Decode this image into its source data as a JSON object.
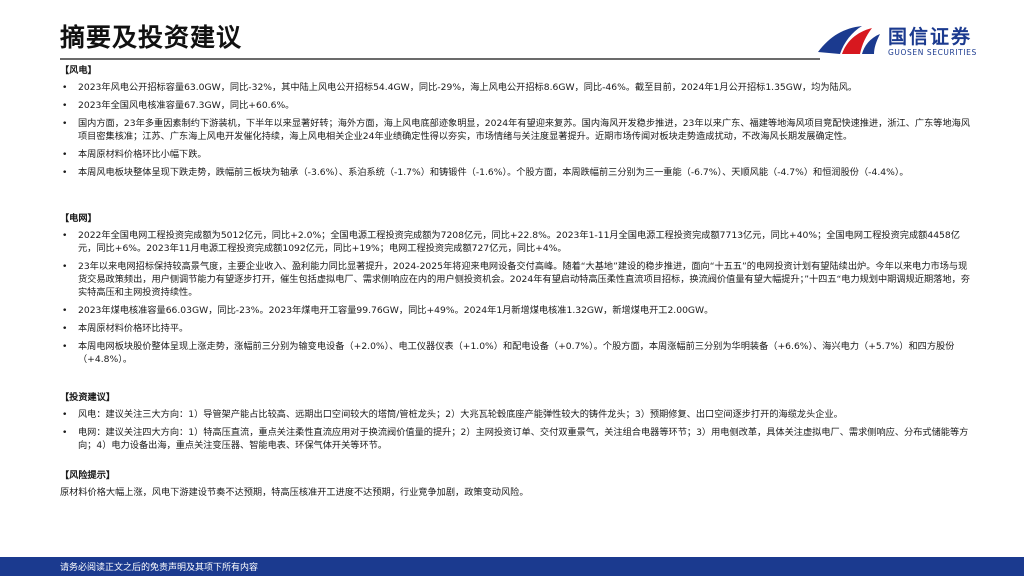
{
  "page": {
    "title": "摘要及投资建议"
  },
  "brand": {
    "name_cn": "国信证券",
    "name_en": "GUOSEN SECURITIES",
    "primary_color": "#1b3a8f",
    "accent_color": "#d7181f"
  },
  "sections": {
    "wind": {
      "heading": "【风电】",
      "items": [
        "2023年风电公开招标容量63.0GW，同比-32%，其中陆上风电公开招标54.4GW，同比-29%，海上风电公开招标8.6GW，同比-46%。截至目前，2024年1月公开招标1.35GW，均为陆风。",
        "2023年全国风电核准容量67.3GW，同比+60.6%。",
        "国内方面，23年多重因素制约下游装机，下半年以来显著好转；海外方面，海上风电底部迹象明显，2024年有望迎来复苏。国内海风开发稳步推进，23年以来广东、福建等地海风项目竞配快速推进，浙江、广东等地海风项目密集核准；江苏、广东海上风电开发催化持续，海上风电相关企业24年业绩确定性得以夯实，市场情绪与关注度显著提升。近期市场传闻对板块走势造成扰动，不改海风长期发展确定性。",
        "本周原材料价格环比小幅下跌。",
        "本周风电板块整体呈现下跌走势，跌幅前三板块为轴承（-3.6%）、系泊系统（-1.7%）和铸锻件（-1.6%）。个股方面，本周跌幅前三分别为三一重能（-6.7%）、天顺风能（-4.7%）和恒润股份（-4.4%）。"
      ]
    },
    "grid": {
      "heading": "【电网】",
      "items": [
        "2022年全国电网工程投资完成额为5012亿元，同比+2.0%；全国电源工程投资完成额为7208亿元，同比+22.8%。2023年1-11月全国电源工程投资完成额7713亿元，同比+40%；全国电网工程投资完成额4458亿元，同比+6%。2023年11月电源工程投资完成额1092亿元，同比+19%；电网工程投资完成额727亿元，同比+4%。",
        "23年以来电网招标保持较高景气度，主要企业收入、盈利能力同比显著提升，2024-2025年将迎来电网设备交付高峰。随着“大基地”建设的稳步推进，面向“十五五”的电网投资计划有望陆续出炉。今年以来电力市场与现货交易政策频出，用户侧调节能力有望逐步打开，催生包括虚拟电厂、需求侧响应在内的用户侧投资机会。2024年有望启动特高压柔性直流项目招标，换流阀价值量有望大幅提升；”十四五“电力规划中期调规近期落地，夯实特高压和主网投资持续性。",
        "2023年煤电核准容量66.03GW，同比-23%。2023年煤电开工容量99.76GW，同比+49%。2024年1月新增煤电核准1.32GW，新增煤电开工2.00GW。",
        "本周原材料价格环比持平。",
        "本周电网板块股价整体呈现上涨走势，涨幅前三分别为输变电设备（+2.0%）、电工仪器仪表（+1.0%）和配电设备（+0.7%）。个股方面，本周涨幅前三分别为华明装备（+6.6%）、海兴电力（+5.7%）和四方股份（+4.8%）。"
      ]
    },
    "advice": {
      "heading": "【投资建议】",
      "items": [
        "风电：建议关注三大方向：1）导管架产能占比较高、远期出口空间较大的塔筒/管桩龙头；2）大兆瓦轮毂底座产能弹性较大的铸件龙头；3）预期修复、出口空间逐步打开的海缆龙头企业。",
        "电网：建议关注四大方向：1）特高压直流，重点关注柔性直流应用对于换流阀价值量的提升；2）主网投资订单、交付双重景气，关注组合电器等环节；3）用电侧改革，具体关注虚拟电厂、需求侧响应、分布式储能等方向；4）电力设备出海，重点关注变压器、智能电表、环保气体开关等环节。"
      ]
    },
    "risk": {
      "heading": "【风险提示】",
      "text": "原材料价格大幅上涨，风电下游建设节奏不达预期，特高压核准开工进度不达预期，行业竞争加剧，政策变动风险。"
    }
  },
  "footer": {
    "disclaimer": "请务必阅读正文之后的免责声明及其项下所有内容"
  }
}
